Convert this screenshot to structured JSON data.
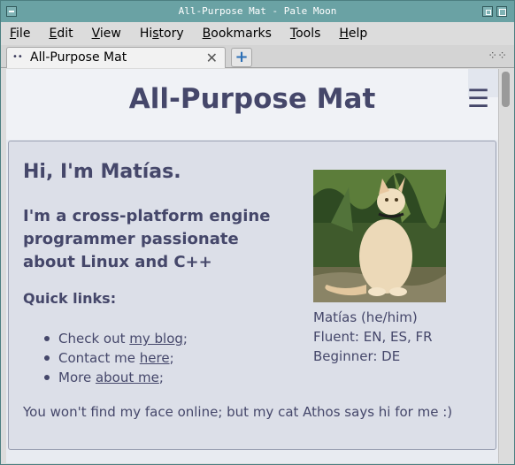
{
  "window": {
    "title": "All-Purpose Mat - Pale Moon"
  },
  "menubar": {
    "items": [
      {
        "label": "File",
        "accel": "F",
        "rest": "ile"
      },
      {
        "label": "Edit",
        "accel": "E",
        "rest": "dit"
      },
      {
        "label": "View",
        "accel": "V",
        "rest": "iew"
      },
      {
        "label": "History",
        "accel": "s",
        "pre": "Hi",
        "rest": "tory"
      },
      {
        "label": "Bookmarks",
        "accel": "B",
        "rest": "ookmarks"
      },
      {
        "label": "Tools",
        "accel": "T",
        "rest": "ools"
      },
      {
        "label": "Help",
        "accel": "H",
        "rest": "elp"
      }
    ]
  },
  "tabs": {
    "active_label": "All-Purpose Mat",
    "new_tab_symbol": "+",
    "list_icon": "grid-icon"
  },
  "page": {
    "site_title": "All-Purpose Mat",
    "menu_icon": "hamburger-icon",
    "greeting": "Hi, I'm Matías.",
    "tagline": "I'm a cross-platform engine programmer passionate about Linux and C++",
    "quick_links_heading": "Quick links:",
    "links": [
      {
        "prefix": "Check out ",
        "link": "my blog",
        "suffix": ";"
      },
      {
        "prefix": "Contact me ",
        "link": "here",
        "suffix": ";"
      },
      {
        "prefix": "More ",
        "link": "about me",
        "suffix": ";"
      }
    ],
    "footer": "You won't find my face online; but my cat Athos says hi for me :)",
    "caption": {
      "name": "Matías (he/him)",
      "fluent": "Fluent: EN, ES, FR",
      "beginner": "Beginner: DE"
    }
  },
  "colors": {
    "titlebar": "#6aa2a4",
    "text_accent": "#45476a",
    "card_bg": "#dcdfe8"
  }
}
